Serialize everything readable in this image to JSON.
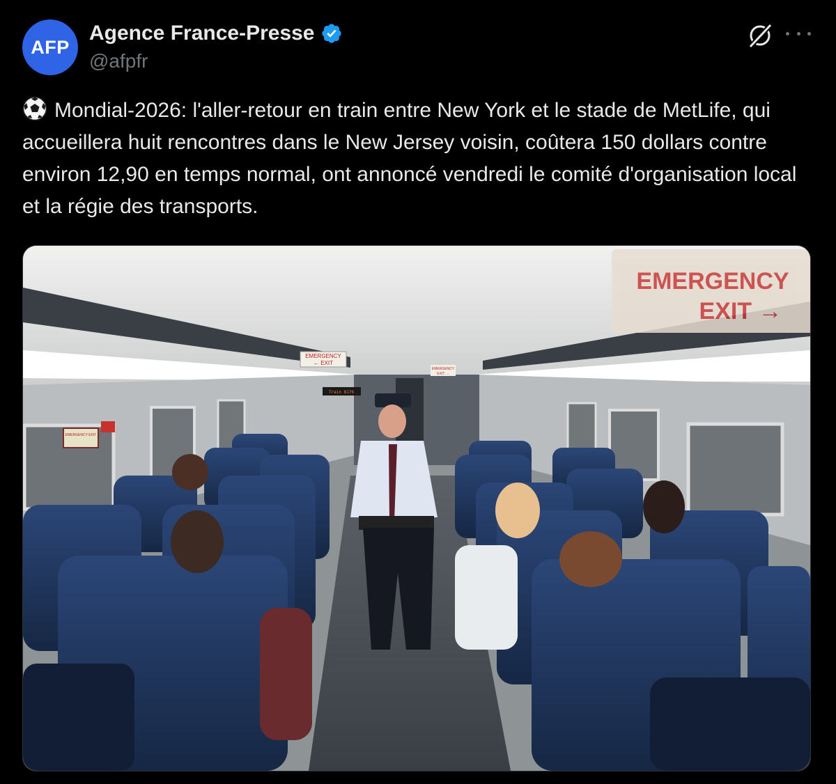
{
  "author": {
    "avatar_text": "AFP",
    "display_name": "Agence France-Presse",
    "handle": "@afpfr",
    "verified": true
  },
  "tweet": {
    "emoji_icon": "soccer-ball-icon",
    "text": "Mondial-2026: l'aller-retour en train entre New York et le stade de MetLife, qui accueillera huit rencontres dans le New Jersey voisin, coûtera 150 dollars contre environ 12,90 en temps normal, ont annoncé vendredi le comité d'organisation local et la régie des transports."
  },
  "photo": {
    "signs": {
      "big_sign_line1": "EMERGENCY",
      "big_sign_line2": "EXIT →",
      "small_sign_line1": "EMERGENCY",
      "small_sign_line2": "← EXIT",
      "tiny_sign_line1": "EMERGENCY",
      "tiny_sign_line2": "EXIT →",
      "side_sign": "EMERGENCY EXIT",
      "destination_display": "Train 8176"
    }
  },
  "colors": {
    "background": "#000000",
    "text": "#e7e9ea",
    "muted": "#71767b",
    "verified": "#1d9bf0",
    "avatar": "#2f64e6",
    "seat": "#233a63"
  }
}
